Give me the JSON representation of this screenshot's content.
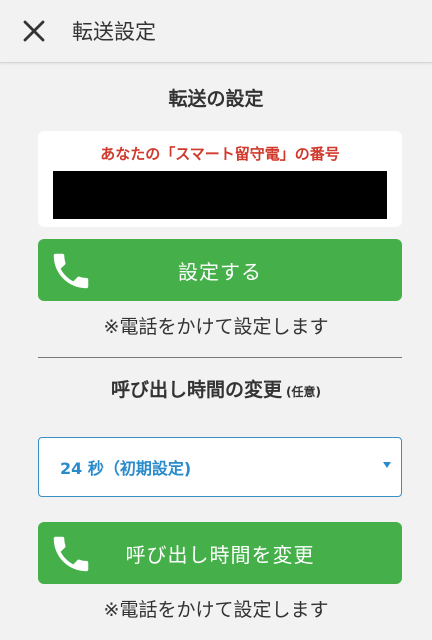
{
  "appbar": {
    "title": "転送設定",
    "close_icon": "close-icon"
  },
  "forward": {
    "heading": "転送の設定",
    "number_label": "あなたの「スマート留守電」の番号",
    "setup_button": "設定する",
    "note": "※電話をかけて設定します"
  },
  "ring_time": {
    "heading": "呼び出し時間の変更",
    "optional": "(任意)",
    "select_value": "24 秒（初期設定)",
    "change_button": "呼び出し時間を変更",
    "note": "※電話をかけて設定します"
  },
  "colors": {
    "green": "#45b04a",
    "red_label": "#d0392b",
    "select_blue": "#2a8bcc"
  }
}
